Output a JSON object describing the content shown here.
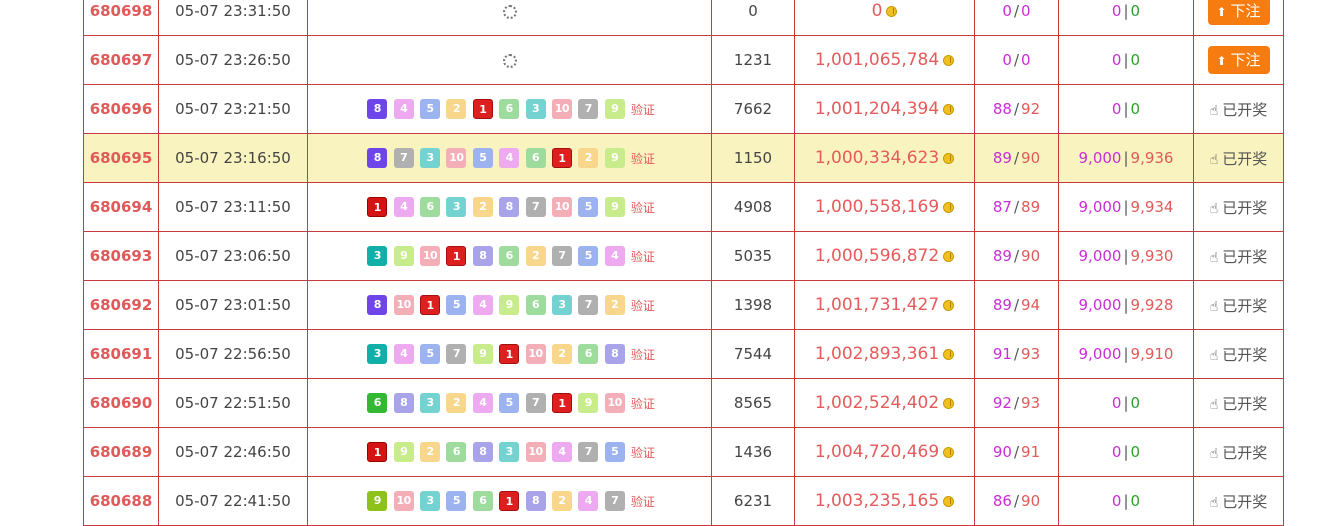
{
  "actions": {
    "bet_label": "下注",
    "drawn_label": "已开奖",
    "verify_label": "验证"
  },
  "rows": [
    {
      "issue": "680698",
      "time": "05-07 23:31:50",
      "balls": [],
      "bets": "0",
      "pool": "0",
      "win_a": "0",
      "win_b": "0",
      "amt_a": "0",
      "amt_b": "0",
      "status": "bet"
    },
    {
      "issue": "680697",
      "time": "05-07 23:26:50",
      "balls": [],
      "bets": "1231",
      "pool": "1,001,065,784",
      "win_a": "0",
      "win_b": "0",
      "amt_a": "0",
      "amt_b": "0",
      "status": "bet"
    },
    {
      "issue": "680696",
      "time": "05-07 23:21:50",
      "balls": [
        8,
        4,
        5,
        2,
        1,
        6,
        3,
        10,
        7,
        9
      ],
      "bets": "7662",
      "pool": "1,001,204,394",
      "win_a": "88",
      "win_b": "92",
      "amt_a": "0",
      "amt_b": "0",
      "status": "drawn"
    },
    {
      "issue": "680695",
      "time": "05-07 23:16:50",
      "balls": [
        8,
        7,
        3,
        10,
        5,
        4,
        6,
        1,
        2,
        9
      ],
      "bets": "1150",
      "pool": "1,000,334,623",
      "win_a": "89",
      "win_b": "90",
      "amt_a": "9,000",
      "amt_b": "9,936",
      "status": "drawn",
      "highlight": true
    },
    {
      "issue": "680694",
      "time": "05-07 23:11:50",
      "balls": [
        1,
        4,
        6,
        3,
        2,
        8,
        7,
        10,
        5,
        9
      ],
      "bets": "4908",
      "pool": "1,000,558,169",
      "win_a": "87",
      "win_b": "89",
      "amt_a": "9,000",
      "amt_b": "9,934",
      "status": "drawn"
    },
    {
      "issue": "680693",
      "time": "05-07 23:06:50",
      "balls": [
        3,
        9,
        10,
        1,
        8,
        6,
        2,
        7,
        5,
        4
      ],
      "bets": "5035",
      "pool": "1,000,596,872",
      "win_a": "89",
      "win_b": "90",
      "amt_a": "9,000",
      "amt_b": "9,930",
      "status": "drawn"
    },
    {
      "issue": "680692",
      "time": "05-07 23:01:50",
      "balls": [
        8,
        10,
        1,
        5,
        4,
        9,
        6,
        3,
        7,
        2
      ],
      "bets": "1398",
      "pool": "1,001,731,427",
      "win_a": "89",
      "win_b": "94",
      "amt_a": "9,000",
      "amt_b": "9,928",
      "status": "drawn"
    },
    {
      "issue": "680691",
      "time": "05-07 22:56:50",
      "balls": [
        3,
        4,
        5,
        7,
        9,
        1,
        10,
        2,
        6,
        8
      ],
      "bets": "7544",
      "pool": "1,002,893,361",
      "win_a": "91",
      "win_b": "93",
      "amt_a": "9,000",
      "amt_b": "9,910",
      "status": "drawn"
    },
    {
      "issue": "680690",
      "time": "05-07 22:51:50",
      "balls": [
        6,
        8,
        3,
        2,
        4,
        5,
        7,
        1,
        9,
        10
      ],
      "bets": "8565",
      "pool": "1,002,524,402",
      "win_a": "92",
      "win_b": "93",
      "amt_a": "0",
      "amt_b": "0",
      "status": "drawn"
    },
    {
      "issue": "680689",
      "time": "05-07 22:46:50",
      "balls": [
        1,
        9,
        2,
        6,
        8,
        3,
        10,
        4,
        7,
        5
      ],
      "bets": "1436",
      "pool": "1,004,720,469",
      "win_a": "90",
      "win_b": "91",
      "amt_a": "0",
      "amt_b": "0",
      "status": "drawn"
    },
    {
      "issue": "680688",
      "time": "05-07 22:41:50",
      "balls": [
        9,
        10,
        3,
        5,
        6,
        1,
        8,
        2,
        4,
        7
      ],
      "bets": "6231",
      "pool": "1,003,235,165",
      "win_a": "86",
      "win_b": "90",
      "amt_a": "0",
      "amt_b": "0",
      "status": "drawn"
    }
  ]
}
